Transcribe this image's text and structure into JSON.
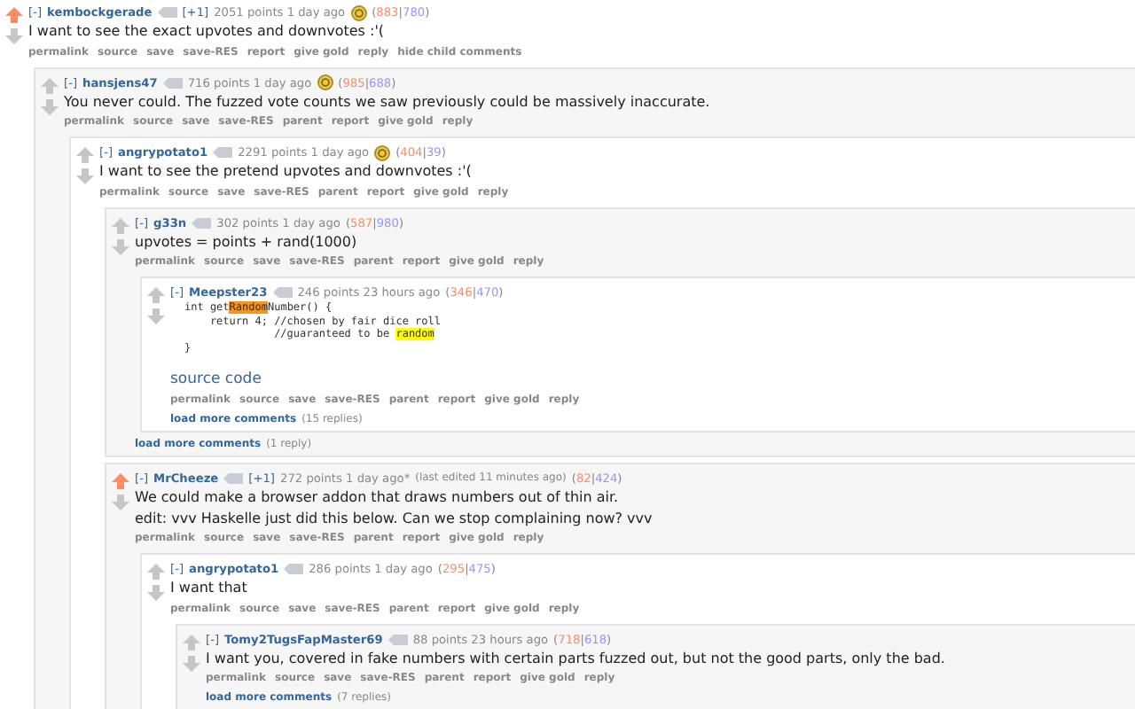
{
  "comments": [
    {
      "collapse": "[-]",
      "author": "kembockgerade",
      "vote_tag": "[+1]",
      "meta": "2051 points 1 day ago",
      "gold": true,
      "upvoted": true,
      "score": [
        {
          "kind": "punct",
          "text": "("
        },
        {
          "kind": "up",
          "text": "883"
        },
        {
          "kind": "punct",
          "text": "|"
        },
        {
          "kind": "down",
          "text": "780"
        },
        {
          "kind": "punct",
          "text": ")"
        }
      ],
      "body": [
        {
          "kind": "text",
          "text": "I want to see the exact upvotes and downvotes :'("
        }
      ],
      "buttons": [
        "permalink",
        "source",
        "save",
        "save-RES",
        "report",
        "give gold",
        "reply",
        "hide child comments"
      ],
      "children": [
        {
          "collapse": "[-]",
          "author": "hansjens47",
          "meta": "716 points 1 day ago",
          "gold": true,
          "upvoted": false,
          "score": [
            {
              "kind": "punct",
              "text": "("
            },
            {
              "kind": "up",
              "text": "985"
            },
            {
              "kind": "punct",
              "text": "|"
            },
            {
              "kind": "down",
              "text": "688"
            },
            {
              "kind": "punct",
              "text": ")"
            }
          ],
          "body": [
            {
              "kind": "text",
              "text": "You never could. The fuzzed vote counts we saw previously could be massively inaccurate."
            }
          ],
          "buttons": [
            "permalink",
            "source",
            "save",
            "save-RES",
            "parent",
            "report",
            "give gold",
            "reply"
          ],
          "children": [
            {
              "collapse": "[-]",
              "author": "angrypotato1",
              "meta": "2291 points 1 day ago",
              "gold": true,
              "upvoted": false,
              "score": [
                {
                  "kind": "punct",
                  "text": "("
                },
                {
                  "kind": "up",
                  "text": "404"
                },
                {
                  "kind": "punct",
                  "text": "|"
                },
                {
                  "kind": "down",
                  "text": "39"
                },
                {
                  "kind": "punct",
                  "text": ")"
                }
              ],
              "body": [
                {
                  "kind": "text",
                  "text": "I want to see the pretend upvotes and downvotes :'("
                }
              ],
              "buttons": [
                "permalink",
                "source",
                "save",
                "save-RES",
                "parent",
                "report",
                "give gold",
                "reply"
              ],
              "children": [
                {
                  "collapse": "[-]",
                  "author": "g33n",
                  "meta": "302 points 1 day ago",
                  "gold": false,
                  "upvoted": false,
                  "score": [
                    {
                      "kind": "punct",
                      "text": "("
                    },
                    {
                      "kind": "up",
                      "text": "587"
                    },
                    {
                      "kind": "punct",
                      "text": "|"
                    },
                    {
                      "kind": "down",
                      "text": "980"
                    },
                    {
                      "kind": "punct",
                      "text": ")"
                    }
                  ],
                  "body": [
                    {
                      "kind": "text",
                      "text": "upvotes = points + rand(1000)"
                    }
                  ],
                  "buttons": [
                    "permalink",
                    "source",
                    "save",
                    "save-RES",
                    "parent",
                    "report",
                    "give gold",
                    "reply"
                  ],
                  "children": [
                    {
                      "collapse": "[-]",
                      "author": "Meepster23",
                      "meta": "246 points 23 hours ago",
                      "gold": false,
                      "upvoted": false,
                      "score": [
                        {
                          "kind": "punct",
                          "text": "("
                        },
                        {
                          "kind": "up",
                          "text": "346"
                        },
                        {
                          "kind": "punct",
                          "text": "|"
                        },
                        {
                          "kind": "down",
                          "text": "470"
                        },
                        {
                          "kind": "punct",
                          "text": ")"
                        }
                      ],
                      "body": [
                        {
                          "kind": "code",
                          "lines": [
                            [
                              {
                                "text": "int get"
                              },
                              {
                                "text": "Random",
                                "color": "#f7941d"
                              },
                              {
                                "text": "Number() {"
                              }
                            ],
                            [
                              {
                                "text": "    return 4; //chosen by fair dice roll"
                              }
                            ],
                            [
                              {
                                "text": "              //guaranteed to be "
                              },
                              {
                                "text": "random",
                                "color": "#ffff00"
                              }
                            ],
                            [
                              {
                                "text": "}"
                              }
                            ]
                          ]
                        },
                        {
                          "kind": "link",
                          "text": "source code"
                        }
                      ],
                      "buttons": [
                        "permalink",
                        "source",
                        "save",
                        "save-RES",
                        "parent",
                        "report",
                        "give gold",
                        "reply"
                      ],
                      "load_more": {
                        "label": "load more comments",
                        "count": "(15 replies)"
                      }
                    }
                  ],
                  "load_more": {
                    "label": "load more comments",
                    "count": "(1 reply)"
                  }
                },
                {
                  "collapse": "[-]",
                  "author": "MrCheeze",
                  "vote_tag": "[+1]",
                  "meta": "272 points 1 day ago*",
                  "edited": "(last edited 11 minutes ago)",
                  "gold": false,
                  "upvoted": true,
                  "score": [
                    {
                      "kind": "punct",
                      "text": "("
                    },
                    {
                      "kind": "up",
                      "text": "82"
                    },
                    {
                      "kind": "punct",
                      "text": "|"
                    },
                    {
                      "kind": "down",
                      "text": "424"
                    },
                    {
                      "kind": "punct",
                      "text": ")"
                    }
                  ],
                  "body": [
                    {
                      "kind": "text",
                      "text": "We could make a browser addon that draws numbers out of thin air."
                    },
                    {
                      "kind": "text",
                      "text": "edit: vvv Haskelle just did this below. Can we stop complaining now? vvv"
                    }
                  ],
                  "buttons": [
                    "permalink",
                    "source",
                    "save",
                    "save-RES",
                    "parent",
                    "report",
                    "give gold",
                    "reply"
                  ],
                  "children": [
                    {
                      "collapse": "[-]",
                      "author": "angrypotato1",
                      "meta": "286 points 1 day ago",
                      "gold": false,
                      "upvoted": false,
                      "score": [
                        {
                          "kind": "punct",
                          "text": "("
                        },
                        {
                          "kind": "up",
                          "text": "295"
                        },
                        {
                          "kind": "punct",
                          "text": "|"
                        },
                        {
                          "kind": "down",
                          "text": "475"
                        },
                        {
                          "kind": "punct",
                          "text": ")"
                        }
                      ],
                      "body": [
                        {
                          "kind": "text",
                          "text": "I want that"
                        }
                      ],
                      "buttons": [
                        "permalink",
                        "source",
                        "save",
                        "save-RES",
                        "parent",
                        "report",
                        "give gold",
                        "reply"
                      ],
                      "children": [
                        {
                          "collapse": "[-]",
                          "author": "Tomy2TugsFapMaster69",
                          "meta": "88 points 23 hours ago",
                          "gold": false,
                          "upvoted": false,
                          "score": [
                            {
                              "kind": "punct",
                              "text": "("
                            },
                            {
                              "kind": "up",
                              "text": "718"
                            },
                            {
                              "kind": "punct",
                              "text": "|"
                            },
                            {
                              "kind": "down",
                              "text": "618"
                            },
                            {
                              "kind": "punct",
                              "text": ")"
                            }
                          ],
                          "body": [
                            {
                              "kind": "text",
                              "text": "I want you, covered in fake numbers with certain parts fuzzed out, but not the good parts, only the bad."
                            }
                          ],
                          "buttons": [
                            "permalink",
                            "source",
                            "save",
                            "save-RES",
                            "parent",
                            "report",
                            "give gold",
                            "reply"
                          ],
                          "load_more": {
                            "label": "load more comments",
                            "count": "(7 replies)"
                          }
                        }
                      ]
                    }
                  ]
                }
              ]
            }
          ]
        }
      ]
    }
  ]
}
